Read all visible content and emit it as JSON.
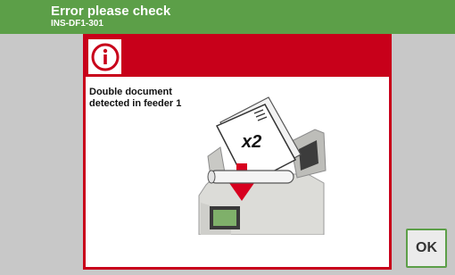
{
  "header": {
    "title": "Error please check",
    "code": "INS-DF1-301",
    "color": "#5c9f48"
  },
  "dialog": {
    "accent_color": "#c8001a",
    "icon": "info-icon",
    "message_lines": [
      "Double document",
      "detected in feeder 1"
    ],
    "illustration": {
      "icon": "double-document-feeder-illustration",
      "multiplier_label": "x2"
    }
  },
  "actions": {
    "ok_label": "OK"
  }
}
